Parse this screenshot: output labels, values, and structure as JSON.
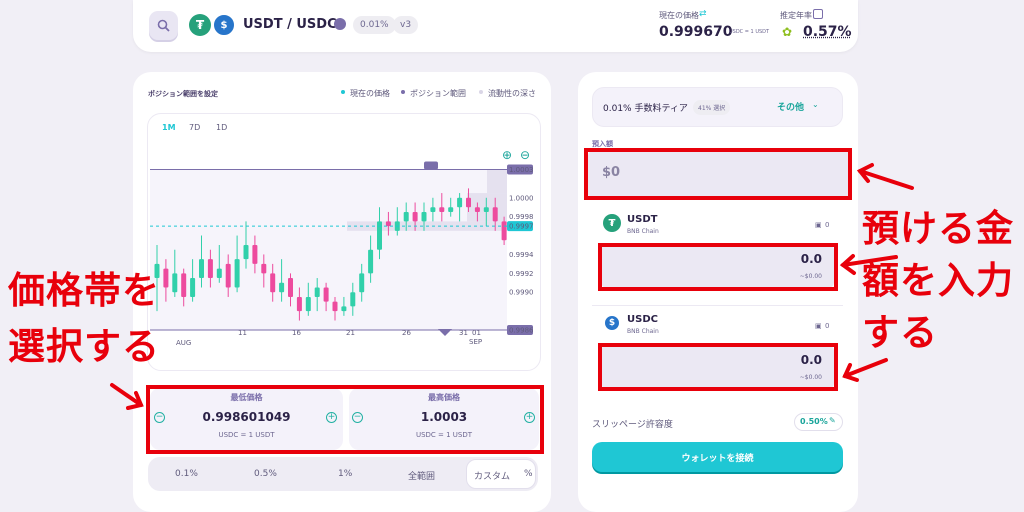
{
  "header": {
    "pair": "USDT / USDC",
    "fee_badge": "0.01%",
    "version_badge": "v3",
    "current_price_label": "現在の価格",
    "current_price_value": "0.999670",
    "current_price_unit": "USDC = 1 USDT",
    "apr_label": "推定年率",
    "apr_value": "0.57%"
  },
  "range": {
    "title": "ポジション範囲を設定",
    "legend": [
      "現在の価格",
      "ポジション範囲",
      "流動性の深さ"
    ],
    "tabs": [
      "1M",
      "7D",
      "1D"
    ],
    "min_label": "最低価格",
    "min_value": "0.998601049",
    "min_unit": "USDC = 1 USDT",
    "max_label": "最高価格",
    "max_value": "1.0003",
    "max_unit": "USDC = 1 USDT",
    "presets": [
      "0.1%",
      "0.5%",
      "1%",
      "全範囲",
      "カスタム",
      "%"
    ]
  },
  "deposit": {
    "fee_tier_label": "0.01% 手数料ティア",
    "fee_tier_badge": "41% 選択",
    "more_label": "その他",
    "amount_label": "預入額",
    "amount_value": "$0",
    "tokens": [
      {
        "symbol": "USDT",
        "chain": "BNB Chain",
        "balance": "0",
        "amount": "0.0",
        "usd": "~$0.00"
      },
      {
        "symbol": "USDC",
        "chain": "BNB Chain",
        "balance": "0",
        "amount": "0.0",
        "usd": "~$0.00"
      }
    ],
    "slippage_label": "スリッページ許容度",
    "slippage_value": "0.50%",
    "connect_label": "ウォレットを接続"
  },
  "annotations": {
    "left": "価格帯を選択する",
    "right": "預ける金額を入力する"
  },
  "colors": {
    "accent": "#1fc7d4",
    "up": "#31d0aa",
    "down": "#ed4b9e",
    "range": "#7a6eaa",
    "annotation": "#e8000b"
  },
  "chart_data": {
    "type": "candlestick",
    "x_tick_labels": [
      "AUG",
      "11",
      "16",
      "21",
      "26",
      "31",
      "01",
      "SEP"
    ],
    "y_tick_labels": [
      "1.0003",
      "1.0000",
      "0.9998",
      "0.9997",
      "0.9994",
      "0.9992",
      "0.9990",
      "0.9986"
    ],
    "ylim": [
      0.9986,
      1.0004
    ],
    "range_upper": 1.0003,
    "range_lower": 0.9986,
    "current_price": 0.9997,
    "candles": [
      [
        0.99915,
        0.9993,
        0.9988,
        0.9995
      ],
      [
        0.99925,
        0.99905,
        0.9989,
        0.99935
      ],
      [
        0.999,
        0.9992,
        0.99895,
        0.99945
      ],
      [
        0.9992,
        0.99895,
        0.99885,
        0.99925
      ],
      [
        0.99895,
        0.99915,
        0.9989,
        0.99935
      ],
      [
        0.99915,
        0.99935,
        0.99905,
        0.9996
      ],
      [
        0.99935,
        0.99915,
        0.99905,
        0.99945
      ],
      [
        0.99915,
        0.99925,
        0.9991,
        0.9995
      ],
      [
        0.9993,
        0.99905,
        0.99895,
        0.9994
      ],
      [
        0.99905,
        0.99935,
        0.999,
        0.9996
      ],
      [
        0.99935,
        0.9995,
        0.99925,
        0.99975
      ],
      [
        0.9995,
        0.9993,
        0.9992,
        0.9996
      ],
      [
        0.9993,
        0.9992,
        0.99905,
        0.9994
      ],
      [
        0.9992,
        0.999,
        0.9989,
        0.9993
      ],
      [
        0.999,
        0.9991,
        0.9989,
        0.99935
      ],
      [
        0.99915,
        0.99895,
        0.99885,
        0.9992
      ],
      [
        0.99895,
        0.9988,
        0.9987,
        0.99905
      ],
      [
        0.9988,
        0.99895,
        0.99875,
        0.9991
      ],
      [
        0.99895,
        0.99905,
        0.9988,
        0.99915
      ],
      [
        0.99905,
        0.9989,
        0.9988,
        0.9991
      ],
      [
        0.9989,
        0.9988,
        0.9987,
        0.99895
      ],
      [
        0.9988,
        0.99885,
        0.99875,
        0.99895
      ],
      [
        0.99885,
        0.999,
        0.99875,
        0.9991
      ],
      [
        0.999,
        0.9992,
        0.9989,
        0.9993
      ],
      [
        0.9992,
        0.99945,
        0.9991,
        0.9996
      ],
      [
        0.99945,
        0.99975,
        0.99935,
        0.9999
      ],
      [
        0.99975,
        0.9997,
        0.9996,
        0.99985
      ],
      [
        0.99965,
        0.99975,
        0.9996,
        0.9999
      ],
      [
        0.99975,
        0.99985,
        0.99965,
        0.99995
      ],
      [
        0.99985,
        0.99975,
        0.99965,
        0.99995
      ],
      [
        0.99975,
        0.99985,
        0.99965,
        0.99995
      ],
      [
        0.99985,
        0.9999,
        0.99975,
        1.0
      ],
      [
        0.9999,
        0.99985,
        0.99975,
        1.00005
      ],
      [
        0.99985,
        0.9999,
        0.9998,
        1.0
      ],
      [
        0.9999,
        1.0,
        0.99975,
        1.00005
      ],
      [
        1.0,
        0.9999,
        0.99985,
        1.0001
      ],
      [
        0.9999,
        0.99985,
        0.99975,
        0.99995
      ],
      [
        0.99985,
        0.9999,
        0.9997,
        1.0
      ],
      [
        0.9999,
        0.99975,
        0.99965,
        1.0
      ],
      [
        0.99975,
        0.99955,
        0.9995,
        0.9998
      ]
    ]
  }
}
